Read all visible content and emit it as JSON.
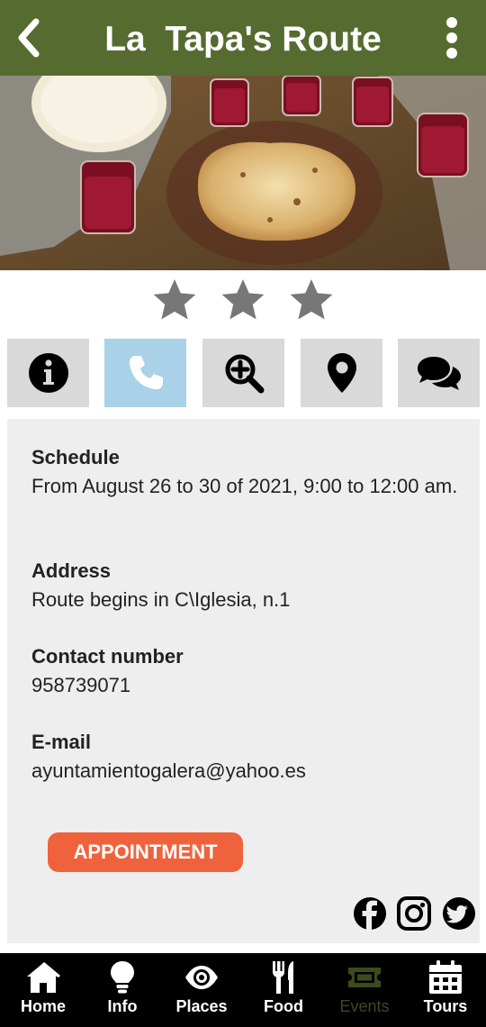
{
  "header": {
    "title": "La  Tapa's Route",
    "back_icon": "chevron-left-icon",
    "menu_icon": "kebab-menu-icon",
    "color": "#556b2f"
  },
  "rating": {
    "stars": 3,
    "icon": "star-icon",
    "color": "#777777"
  },
  "actions": [
    {
      "name": "info",
      "icon": "info-circle-icon"
    },
    {
      "name": "phone",
      "icon": "phone-icon",
      "active": true,
      "active_color": "#a9d1e8"
    },
    {
      "name": "zoom",
      "icon": "zoom-in-icon"
    },
    {
      "name": "location",
      "icon": "map-pin-icon"
    },
    {
      "name": "comments",
      "icon": "comments-icon"
    }
  ],
  "details": {
    "schedule_label": "Schedule",
    "schedule_value": "From August 26 to 30 of 2021, 9:00 to 12:00 am.",
    "address_label": "Address",
    "address_value": "Route begins in C\\Iglesia, n.1",
    "contact_label": "Contact number",
    "contact_value": "958739071",
    "email_label": "E-mail",
    "email_value": "ayuntamientogalera@yahoo.es",
    "appointment_label": "APPOINTMENT",
    "appointment_color": "#f0623c"
  },
  "social": [
    {
      "name": "facebook",
      "icon": "facebook-icon"
    },
    {
      "name": "instagram",
      "icon": "instagram-icon"
    },
    {
      "name": "twitter",
      "icon": "twitter-icon"
    }
  ],
  "nav": [
    {
      "label": "Home",
      "icon": "home-icon"
    },
    {
      "label": "Info",
      "icon": "lightbulb-icon"
    },
    {
      "label": "Places",
      "icon": "eye-icon"
    },
    {
      "label": "Food",
      "icon": "utensils-icon"
    },
    {
      "label": "Events",
      "icon": "ticket-icon",
      "selected": true,
      "selected_color": "#3c4a1e"
    },
    {
      "label": "Tours",
      "icon": "calendar-icon"
    }
  ]
}
